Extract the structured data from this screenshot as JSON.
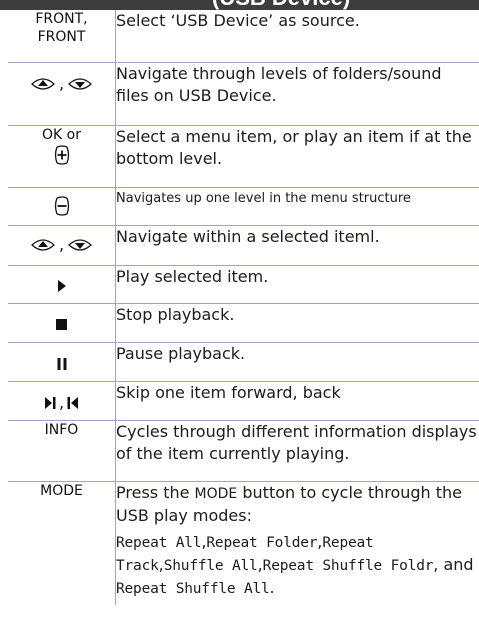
{
  "header": {
    "title": "(USB Device)"
  },
  "rows": [
    {
      "key": [
        "FRONT,",
        "FRONT"
      ],
      "desc": "Select ‘USB Device’ as source."
    },
    {
      "key_icons": [
        "nav-up-icon",
        "nav-down-icon"
      ],
      "key_sep": ",",
      "desc": "Navigate through levels of folders/sound files on USB Device."
    },
    {
      "key": [
        "OK or"
      ],
      "key_icons": [
        "plus-icon"
      ],
      "desc": "Select a menu item, or play an item if at the bottom level."
    },
    {
      "key_icons": [
        "minus-icon"
      ],
      "desc": "Navigates up one level in the menu structure"
    },
    {
      "key_icons": [
        "nav-up-icon",
        "nav-down-icon"
      ],
      "key_sep": ",",
      "desc": "Navigate within a selected iteml."
    },
    {
      "key_icons": [
        "play-icon"
      ],
      "desc": "Play selected item."
    },
    {
      "key_icons": [
        "stop-icon"
      ],
      "desc": "Stop playback."
    },
    {
      "key_icons": [
        "pause-icon"
      ],
      "desc": "Pause playback."
    },
    {
      "key_icons": [
        "skip-forward-icon",
        "skip-back-icon"
      ],
      "key_sep": ",",
      "desc": "Skip one item forward, back"
    },
    {
      "key": [
        "INFO"
      ],
      "desc": "Cycles through different information displays of the item currently playing."
    },
    {
      "key": [
        "MODE"
      ],
      "desc_parts": [
        "Press the ",
        "MODE",
        " button to cycle through the USB play modes:"
      ],
      "modes": [
        "Repeat All",
        "Repeat Folder",
        "Repeat Track",
        "Shuffle All",
        "Repeat Shuffle Foldr",
        "Repeat Shuffle All"
      ],
      "modes_and": "and"
    }
  ]
}
